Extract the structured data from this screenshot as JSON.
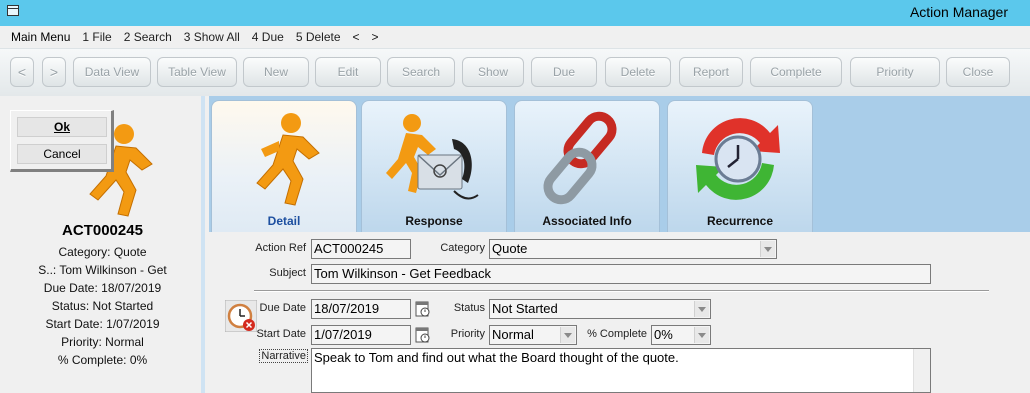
{
  "window": {
    "title": "Action Manager"
  },
  "menu": {
    "items": [
      "Main Menu",
      "1 File",
      "2 Search",
      "3 Show All",
      "4 Due",
      "5 Delete",
      "<",
      ">"
    ]
  },
  "toolbar": {
    "back": "<",
    "forward": ">",
    "buttons": [
      "Data View",
      "Table View",
      "New",
      "Edit",
      "Search",
      "Show",
      "Due",
      "Delete",
      "Report",
      "Complete",
      "Priority",
      "Close"
    ]
  },
  "dialog": {
    "ok": "Ok",
    "cancel": "Cancel"
  },
  "summary": {
    "id": "ACT000245",
    "category": "Category: Quote",
    "subject": "S..: Tom Wilkinson - Get",
    "due": "Due Date: 18/07/2019",
    "status": "Status: Not Started",
    "start": "Start Date: 1/07/2019",
    "priority": "Priority: Normal",
    "complete": "% Complete: 0%"
  },
  "tabs": [
    {
      "label": "Detail",
      "icon": "running-man-icon",
      "active": true
    },
    {
      "label": "Response",
      "icon": "email-phone-icon",
      "active": false
    },
    {
      "label": "Associated Info",
      "icon": "chain-link-icon",
      "active": false
    },
    {
      "label": "Recurrence",
      "icon": "recurrence-clock-icon",
      "active": false
    }
  ],
  "form": {
    "action_ref_label": "Action Ref",
    "action_ref": "ACT000245",
    "category_label": "Category",
    "category": "Quote",
    "subject_label": "Subject",
    "subject": "Tom Wilkinson - Get Feedback",
    "due_date_label": "Due Date",
    "due_date": "18/07/2019",
    "status_label": "Status",
    "status": "Not Started",
    "start_date_label": "Start Date",
    "start_date": "1/07/2019",
    "priority_label": "Priority",
    "priority": "Normal",
    "complete_label": "% Complete",
    "complete": "0%",
    "narrative_label": "Narrative",
    "narrative": "Speak to Tom and find out what the Board thought of the quote."
  },
  "colors": {
    "titlebar": "#5bc8ec",
    "tabstrip": "#a9cde9",
    "active_tab_text": "#1d4fa0"
  }
}
